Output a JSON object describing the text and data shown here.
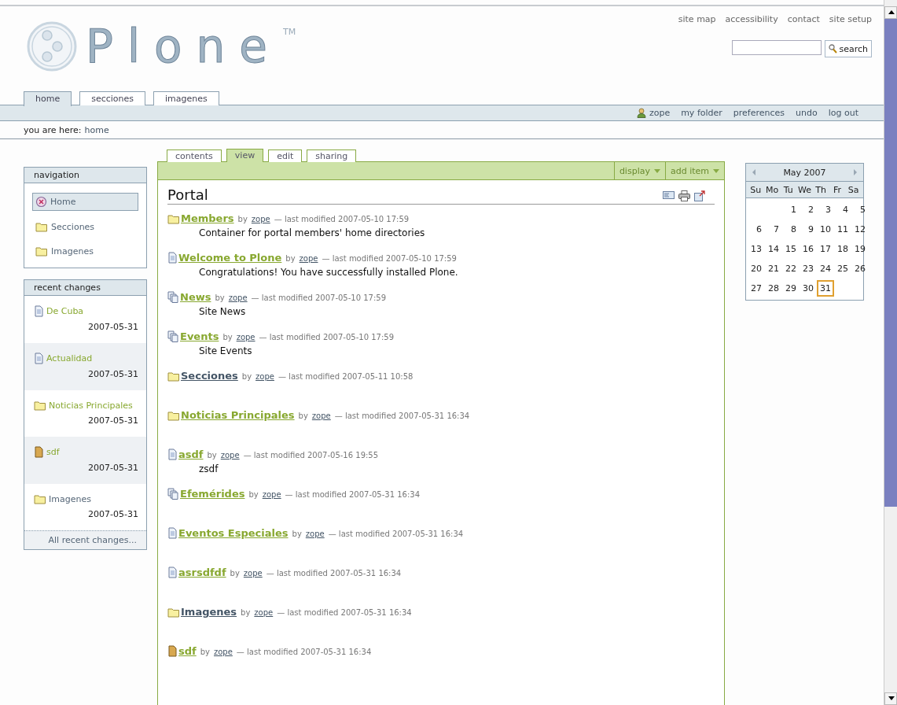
{
  "site_actions": [
    "site map",
    "accessibility",
    "contact",
    "site setup"
  ],
  "logo": {
    "name": "Plone",
    "mark": "TM"
  },
  "search": {
    "button": "search"
  },
  "portal_tabs": [
    {
      "label": "home",
      "selected": true
    },
    {
      "label": "secciones",
      "selected": false
    },
    {
      "label": "imagenes",
      "selected": false
    }
  ],
  "personal_bar": {
    "user": "zope",
    "links": [
      "my folder",
      "preferences",
      "undo",
      "log out"
    ]
  },
  "breadcrumbs": {
    "label": "you are here:",
    "items": [
      "home"
    ]
  },
  "navigation": {
    "title": "navigation",
    "items": [
      {
        "kind": "site",
        "label": "Home",
        "selected": true
      },
      {
        "kind": "folder",
        "label": "Secciones",
        "selected": false
      },
      {
        "kind": "folder",
        "label": "Imagenes",
        "selected": false
      }
    ]
  },
  "recent_changes": {
    "title": "recent changes",
    "items": [
      {
        "kind": "document",
        "title": "De Cuba",
        "date": "2007-05-31",
        "published": true
      },
      {
        "kind": "document",
        "title": "Actualidad",
        "date": "2007-05-31",
        "published": true
      },
      {
        "kind": "folder",
        "title": "Noticias Principales",
        "date": "2007-05-31",
        "published": true
      },
      {
        "kind": "file",
        "title": "sdf",
        "date": "2007-05-31",
        "published": true
      },
      {
        "kind": "folder",
        "title": "Imagenes",
        "date": "2007-05-31",
        "published": false
      }
    ],
    "footer": "All recent changes..."
  },
  "content_tabs": [
    {
      "label": "contents",
      "selected": false
    },
    {
      "label": "view",
      "selected": true
    },
    {
      "label": "edit",
      "selected": false
    },
    {
      "label": "sharing",
      "selected": false
    }
  ],
  "content_menus": [
    "display",
    "add item"
  ],
  "page_title": "Portal",
  "items": [
    {
      "kind": "folder",
      "title": "Members",
      "published": true,
      "by": "by",
      "author": "zope",
      "modified": "— last modified 2007-05-10 17:59",
      "description": "Container for portal members' home directories"
    },
    {
      "kind": "document",
      "title": "Welcome to Plone",
      "published": true,
      "by": "by",
      "author": "zope",
      "modified": "— last modified 2007-05-10 17:59",
      "description": "Congratulations! You have successfully installed Plone."
    },
    {
      "kind": "topic",
      "title": "News",
      "published": true,
      "by": "by",
      "author": "zope",
      "modified": "— last modified 2007-05-10 17:59",
      "description": "Site News"
    },
    {
      "kind": "topic",
      "title": "Events",
      "published": true,
      "by": "by",
      "author": "zope",
      "modified": "— last modified 2007-05-10 17:59",
      "description": "Site Events"
    },
    {
      "kind": "folder",
      "title": "Secciones",
      "published": false,
      "by": "by",
      "author": "zope",
      "modified": "— last modified 2007-05-11 10:58"
    },
    {
      "kind": "folder",
      "title": "Noticias Principales",
      "published": true,
      "by": "by",
      "author": "zope",
      "modified": "— last modified 2007-05-31 16:34"
    },
    {
      "kind": "document",
      "title": "asdf",
      "published": true,
      "by": "by",
      "author": "zope",
      "modified": "— last modified 2007-05-16 19:55",
      "description": "zsdf"
    },
    {
      "kind": "topic",
      "title": "Efemérides",
      "published": true,
      "by": "by",
      "author": "zope",
      "modified": "— last modified 2007-05-31 16:34"
    },
    {
      "kind": "document",
      "title": "Eventos Especiales",
      "published": true,
      "by": "by",
      "author": "zope",
      "modified": "— last modified 2007-05-31 16:34"
    },
    {
      "kind": "document",
      "title": "asrsdfdf",
      "published": true,
      "by": "by",
      "author": "zope",
      "modified": "— last modified 2007-05-31 16:34"
    },
    {
      "kind": "folder",
      "title": "Imagenes",
      "published": false,
      "by": "by",
      "author": "zope",
      "modified": "— last modified 2007-05-31 16:34"
    },
    {
      "kind": "file",
      "title": "sdf",
      "published": true,
      "by": "by",
      "author": "zope",
      "modified": "— last modified 2007-05-31 16:34"
    }
  ],
  "calendar": {
    "month": "May 2007",
    "weekdays": [
      "Su",
      "Mo",
      "Tu",
      "We",
      "Th",
      "Fr",
      "Sa"
    ],
    "weeks": [
      [
        {
          "day": "1",
          "today": false
        },
        {
          "day": "2",
          "today": false
        },
        {
          "day": "3",
          "today": false
        },
        {
          "day": "4",
          "today": false
        },
        {
          "day": "5",
          "today": false
        }
      ],
      [
        {
          "day": "6",
          "today": false
        },
        {
          "day": "7",
          "today": false
        },
        {
          "day": "8",
          "today": false
        },
        {
          "day": "9",
          "today": false
        },
        {
          "day": "10",
          "today": false
        },
        {
          "day": "11",
          "today": false
        },
        {
          "day": "12",
          "today": false
        }
      ],
      [
        {
          "day": "13",
          "today": false
        },
        {
          "day": "14",
          "today": false
        },
        {
          "day": "15",
          "today": false
        },
        {
          "day": "16",
          "today": false
        },
        {
          "day": "17",
          "today": false
        },
        {
          "day": "18",
          "today": false
        },
        {
          "day": "19",
          "today": false
        }
      ],
      [
        {
          "day": "20",
          "today": false
        },
        {
          "day": "21",
          "today": false
        },
        {
          "day": "22",
          "today": false
        },
        {
          "day": "23",
          "today": false
        },
        {
          "day": "24",
          "today": false
        },
        {
          "day": "25",
          "today": false
        },
        {
          "day": "26",
          "today": false
        }
      ],
      [
        {
          "day": "27",
          "today": false
        },
        {
          "day": "28",
          "today": false
        },
        {
          "day": "29",
          "today": false
        },
        {
          "day": "30",
          "today": false
        },
        {
          "day": "31",
          "today": true
        }
      ]
    ]
  }
}
